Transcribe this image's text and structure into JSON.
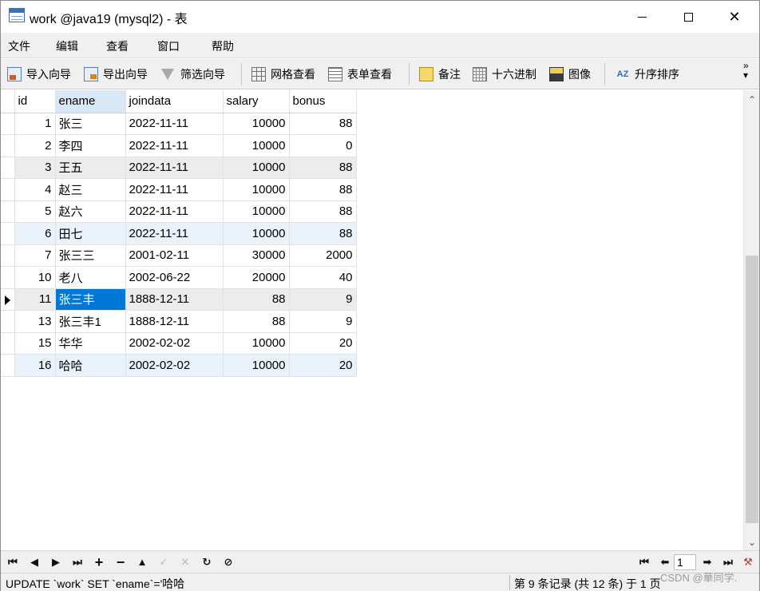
{
  "window": {
    "title": "work @java19 (mysql2) - 表",
    "controls": {
      "minimize": "—",
      "maximize": "☐",
      "close": "✕"
    }
  },
  "menu": {
    "items": [
      "文件",
      "编辑",
      "查看",
      "窗口",
      "帮助"
    ]
  },
  "toolbar": {
    "import": "导入向导",
    "export": "导出向导",
    "filter": "筛选向导",
    "grid_view": "网格查看",
    "form_view": "表单查看",
    "memo": "备注",
    "hex": "十六进制",
    "image": "图像",
    "sort_asc": "升序排序",
    "sort_icon_text": "AZ",
    "overflow": "»"
  },
  "table": {
    "columns": [
      "id",
      "ename",
      "joindata",
      "salary",
      "bonus"
    ],
    "selected_column": "ename",
    "rows": [
      {
        "id": "1",
        "ename": "张三",
        "joindata": "2022-11-11",
        "salary": "10000",
        "bonus": "88"
      },
      {
        "id": "2",
        "ename": "李四",
        "joindata": "2022-11-11",
        "salary": "10000",
        "bonus": "0"
      },
      {
        "id": "3",
        "ename": "王五",
        "joindata": "2022-11-11",
        "salary": "10000",
        "bonus": "88"
      },
      {
        "id": "4",
        "ename": "赵三",
        "joindata": "2022-11-11",
        "salary": "10000",
        "bonus": "88"
      },
      {
        "id": "5",
        "ename": "赵六",
        "joindata": "2022-11-11",
        "salary": "10000",
        "bonus": "88"
      },
      {
        "id": "6",
        "ename": "田七",
        "joindata": "2022-11-11",
        "salary": "10000",
        "bonus": "88"
      },
      {
        "id": "7",
        "ename": "张三三",
        "joindata": "2001-02-11",
        "salary": "30000",
        "bonus": "2000"
      },
      {
        "id": "10",
        "ename": "老八",
        "joindata": "2002-06-22",
        "salary": "20000",
        "bonus": "40"
      },
      {
        "id": "11",
        "ename": "张三丰",
        "joindata": "1888-12-11",
        "salary": "88",
        "bonus": "9"
      },
      {
        "id": "13",
        "ename": "张三丰1",
        "joindata": "1888-12-11",
        "salary": "88",
        "bonus": "9"
      },
      {
        "id": "15",
        "ename": "华华",
        "joindata": "2002-02-02",
        "salary": "10000",
        "bonus": "20"
      },
      {
        "id": "16",
        "ename": "哈哈",
        "joindata": "2002-02-02",
        "salary": "10000",
        "bonus": "20"
      }
    ],
    "current_row_index": 8,
    "selected_cell": {
      "row": 8,
      "column": "ename"
    }
  },
  "navigation": {
    "first": "⏮",
    "prev": "◀",
    "next": "▶",
    "last": "⏭",
    "add": "+",
    "delete": "−",
    "up": "▲",
    "apply": "✓",
    "discard": "✕",
    "refresh": "↻",
    "stop": "⊘",
    "page_first": "⏮",
    "page_prev": "⬅",
    "page_number": "1",
    "page_next": "➡",
    "page_last": "⏭",
    "settings": "⚒"
  },
  "status": {
    "sql": "UPDATE `work` SET `ename`='哈哈",
    "record_info": "第 9 条记录 (共 12 条) 于 1 页"
  },
  "watermark": "CSDN @華同学.",
  "colors": {
    "selection": "#0078d7",
    "stripe": "#eaf2fc",
    "header_selected": "#d9e8f7"
  }
}
